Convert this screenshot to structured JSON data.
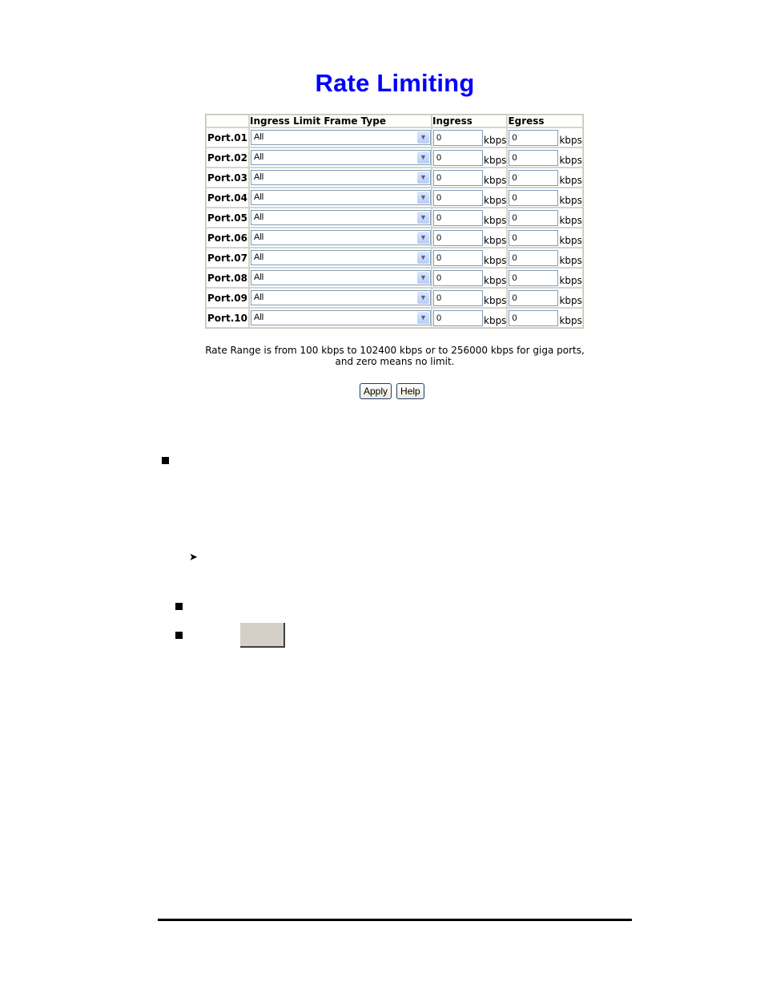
{
  "page_title": "Rate Limiting",
  "table": {
    "headers": {
      "port": "",
      "frame_type": "Ingress Limit Frame Type",
      "ingress": "Ingress",
      "egress": "Egress"
    },
    "unit": "kbps",
    "rows": [
      {
        "port": "Port.01",
        "frame_type": "All",
        "ingress": "0",
        "egress": "0"
      },
      {
        "port": "Port.02",
        "frame_type": "All",
        "ingress": "0",
        "egress": "0"
      },
      {
        "port": "Port.03",
        "frame_type": "All",
        "ingress": "0",
        "egress": "0"
      },
      {
        "port": "Port.04",
        "frame_type": "All",
        "ingress": "0",
        "egress": "0"
      },
      {
        "port": "Port.05",
        "frame_type": "All",
        "ingress": "0",
        "egress": "0"
      },
      {
        "port": "Port.06",
        "frame_type": "All",
        "ingress": "0",
        "egress": "0"
      },
      {
        "port": "Port.07",
        "frame_type": "All",
        "ingress": "0",
        "egress": "0"
      },
      {
        "port": "Port.08",
        "frame_type": "All",
        "ingress": "0",
        "egress": "0"
      },
      {
        "port": "Port.09",
        "frame_type": "All",
        "ingress": "0",
        "egress": "0"
      },
      {
        "port": "Port.10",
        "frame_type": "All",
        "ingress": "0",
        "egress": "0"
      }
    ]
  },
  "note": {
    "line1": "Rate Range is from 100 kbps to 102400 kbps or to 256000 kbps for giga ports,",
    "line2": "and zero means no limit."
  },
  "buttons": {
    "apply": "Apply",
    "help": "Help"
  },
  "icons": {
    "dropdown": "chevron-down-icon",
    "bullet": "square-bullet-icon",
    "arrow_bullet": "arrowhead-bullet-icon"
  },
  "colors": {
    "title": "#0000ff",
    "gray_button": "#d4d0c8"
  }
}
